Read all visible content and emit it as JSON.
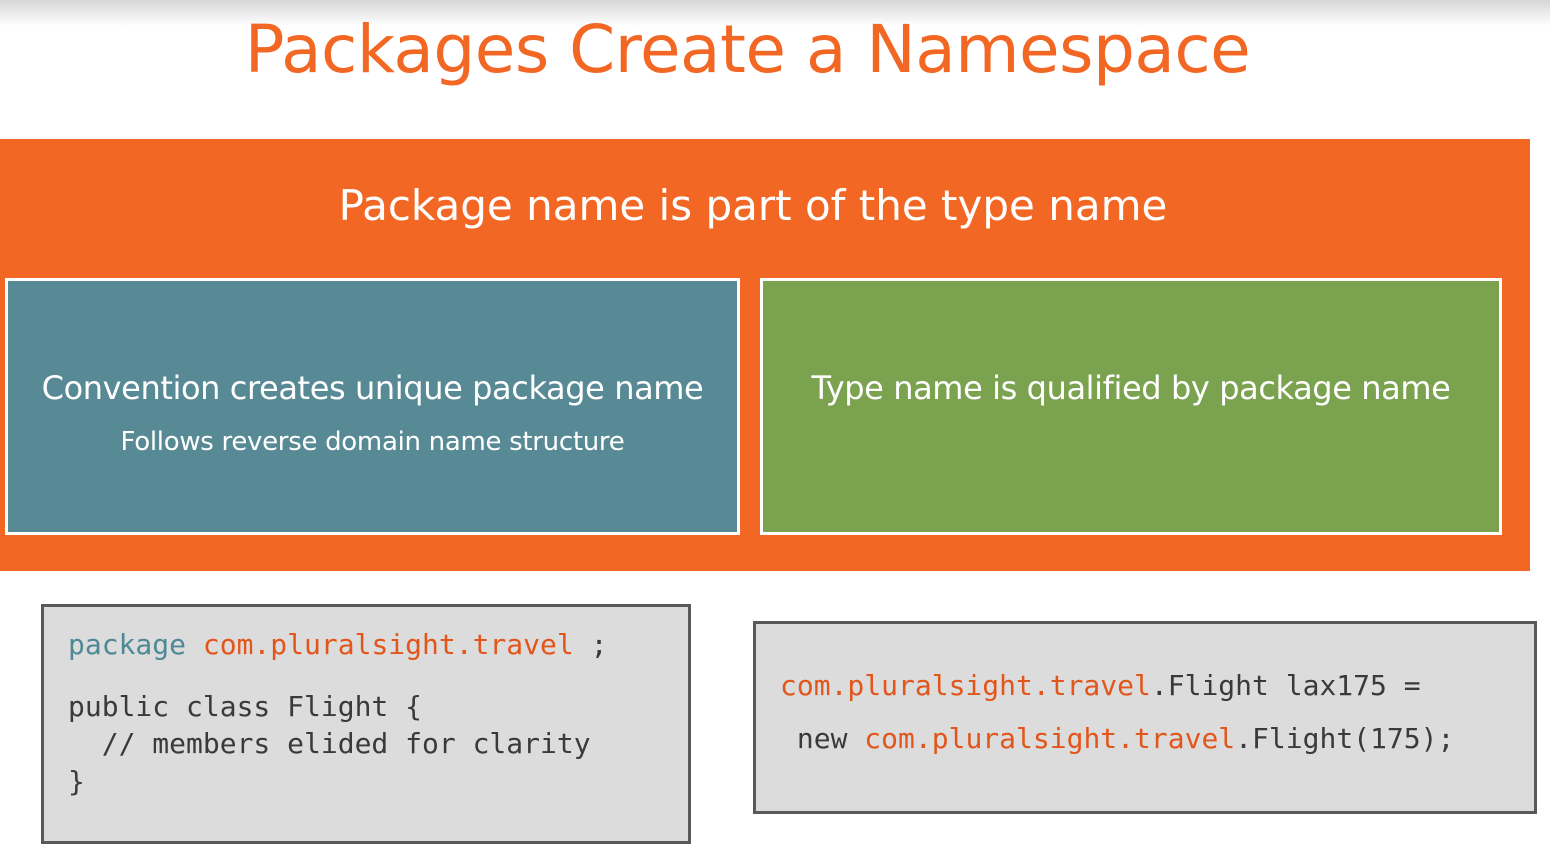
{
  "slide": {
    "title": "Packages Create a Namespace",
    "banner": {
      "heading": "Package name is part of the type name"
    },
    "left_panel": {
      "main_text": "Convention creates unique package name",
      "sub_text": "Follows reverse domain name structure"
    },
    "right_panel": {
      "main_text": "Type name is qualified by package name"
    },
    "code_left": {
      "line1_keyword": "package",
      "line1_space": " ",
      "line1_package": "com.pluralsight.travel",
      "line1_end": " ;",
      "line2": "public class Flight {",
      "line3": "  // members elided for clarity",
      "line4": "}"
    },
    "code_right": {
      "line1_package": "com.pluralsight.travel",
      "line1_rest": ".Flight lax175 =",
      "line2_start": " new ",
      "line2_package": "com.pluralsight.travel",
      "line2_rest": ".Flight(175);"
    }
  },
  "colors": {
    "accent_orange": "#f26724",
    "teal_panel": "#578a94",
    "green_panel": "#7ba24f",
    "code_background": "#dcdcdc",
    "code_border": "#595959"
  }
}
